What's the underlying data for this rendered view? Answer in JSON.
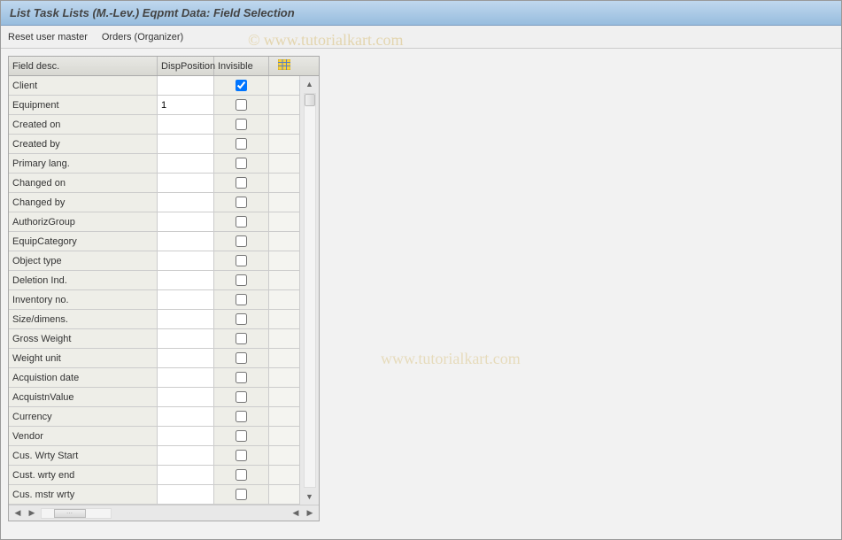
{
  "header": {
    "title": "List Task Lists (M.-Lev.) Eqpmt Data: Field Selection"
  },
  "menu": {
    "reset_user_master": "Reset user master",
    "orders_organizer": "Orders (Organizer)"
  },
  "watermark": {
    "copyright": "©",
    "text1": "www.tutorialkart.com",
    "text2": "www.tutorialkart.com"
  },
  "table": {
    "columns": {
      "field_desc": "Field desc.",
      "disp_position": "DispPosition",
      "invisible": "Invisible"
    },
    "rows": [
      {
        "field": "Client",
        "disp": "",
        "invisible": true
      },
      {
        "field": "Equipment",
        "disp": "1",
        "invisible": false
      },
      {
        "field": "Created on",
        "disp": "",
        "invisible": false
      },
      {
        "field": "Created by",
        "disp": "",
        "invisible": false
      },
      {
        "field": "Primary lang.",
        "disp": "",
        "invisible": false
      },
      {
        "field": "Changed on",
        "disp": "",
        "invisible": false
      },
      {
        "field": "Changed by",
        "disp": "",
        "invisible": false
      },
      {
        "field": "AuthorizGroup",
        "disp": "",
        "invisible": false
      },
      {
        "field": "EquipCategory",
        "disp": "",
        "invisible": false
      },
      {
        "field": "Object type",
        "disp": "",
        "invisible": false
      },
      {
        "field": "Deletion Ind.",
        "disp": "",
        "invisible": false
      },
      {
        "field": "Inventory no.",
        "disp": "",
        "invisible": false
      },
      {
        "field": "Size/dimens.",
        "disp": "",
        "invisible": false
      },
      {
        "field": "Gross Weight",
        "disp": "",
        "invisible": false
      },
      {
        "field": "Weight unit",
        "disp": "",
        "invisible": false
      },
      {
        "field": "Acquistion date",
        "disp": "",
        "invisible": false
      },
      {
        "field": "AcquistnValue",
        "disp": "",
        "invisible": false
      },
      {
        "field": "Currency",
        "disp": "",
        "invisible": false
      },
      {
        "field": "Vendor",
        "disp": "",
        "invisible": false
      },
      {
        "field": "Cus. Wrty Start",
        "disp": "",
        "invisible": false
      },
      {
        "field": "Cust. wrty end",
        "disp": "",
        "invisible": false
      },
      {
        "field": "Cus. mstr wrty",
        "disp": "",
        "invisible": false
      }
    ]
  }
}
